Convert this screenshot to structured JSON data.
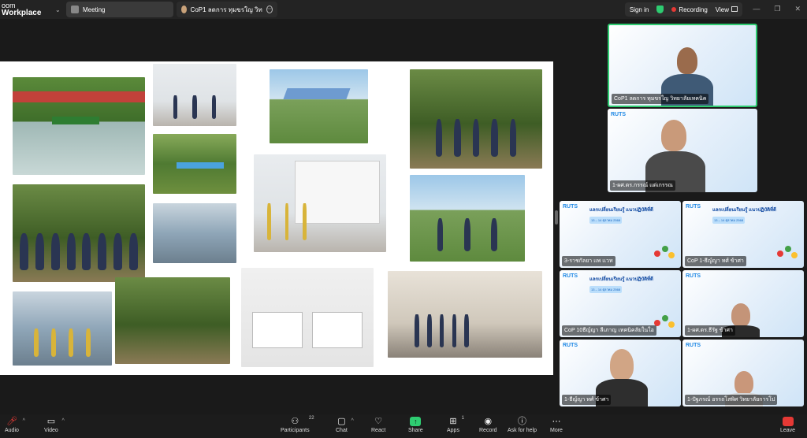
{
  "app": {
    "brand_line1": "oom",
    "brand_line2": "Workplace"
  },
  "tabs": [
    {
      "label": "Meeting"
    },
    {
      "label": "CoP1 ลดการ ทุมขรใญ วิทยาลัยเทคนิค's"
    }
  ],
  "top_right": {
    "sign_in": "Sign in",
    "recording": "Recording",
    "view": "View"
  },
  "participants_tiles": [
    {
      "name": "CoP1 ลดการ ทุมขรใญ วิทยาลัยเทคนิค"
    },
    {
      "name": "1-ผศ.ดร.กรรณ์ แต่เกรรณ"
    },
    {
      "name": "3-ราชกัลยา แพ เเวท"
    },
    {
      "name": "CoP 1-ธีญ์ญา ทศ์ ข้าศา"
    },
    {
      "name": "CoP 10ธีญ์ญา ลีเภาญ เทคนิคลัยในใอ"
    },
    {
      "name": "1-ผศ.ดร.ธีรัฐ ข้าศา"
    },
    {
      "name": "1-ธีญ์ญา ทศ์ ข้าศา"
    },
    {
      "name": "1-ปัฐภรณ์ อรรถโสพิศ วิทยาลัยการโป"
    }
  ],
  "event": {
    "logo": "RUTS",
    "title": "แลกเปลี่ยนเรียนรู้ แนวปฏิบัติที่ดี",
    "date": "13 – 14 ตุลาคม 2568"
  },
  "toolbar": {
    "audio": "Audio",
    "video": "Video",
    "participants": "Participants",
    "participants_count": "22",
    "chat": "Chat",
    "react": "React",
    "share": "Share",
    "apps": "Apps",
    "apps_count": "1",
    "record": "Record",
    "ask_for_help": "Ask for help",
    "more": "More",
    "leave": "Leave"
  }
}
